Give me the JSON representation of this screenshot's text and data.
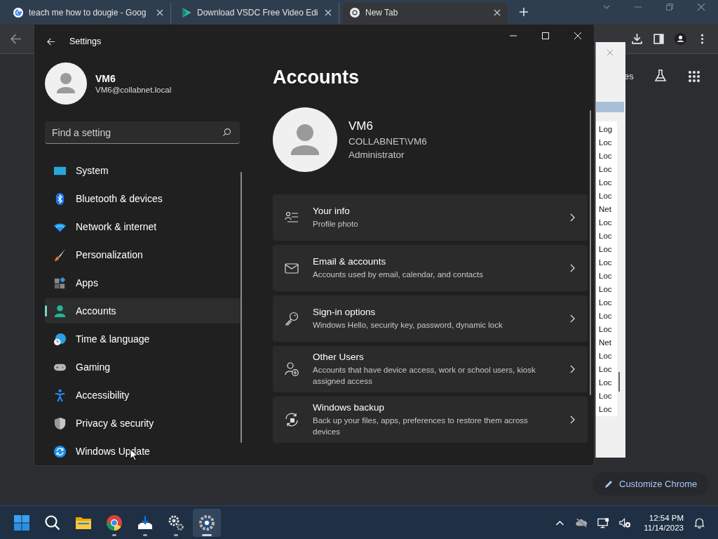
{
  "browser": {
    "tabs": [
      {
        "title": "teach me how to dougie - Goog",
        "kind": "google",
        "selected": false
      },
      {
        "title": "Download VSDC Free Video Edi",
        "kind": "vsdc",
        "selected": false
      },
      {
        "title": "New Tab",
        "kind": "chrome",
        "selected": true
      }
    ]
  },
  "new_tab": {
    "partial_link": "es",
    "customize_button": "Customize Chrome"
  },
  "background_dialog": {
    "rows": [
      "Log",
      "Loc",
      "Loc",
      "Loc",
      "Loc",
      "Loc",
      "Net",
      "Loc",
      "Loc",
      "Loc",
      "Loc",
      "Loc",
      "Loc",
      "Loc",
      "Loc",
      "Loc",
      "Net",
      "Loc",
      "Loc",
      "Loc",
      "Loc",
      "Loc"
    ]
  },
  "settings": {
    "window_title": "Settings",
    "user": {
      "name": "VM6",
      "email": "VM6@collabnet.local"
    },
    "search": {
      "placeholder": "Find a setting"
    },
    "nav": [
      {
        "label": "System",
        "kind": "system",
        "selected": false
      },
      {
        "label": "Bluetooth & devices",
        "kind": "bluetooth",
        "selected": false
      },
      {
        "label": "Network & internet",
        "kind": "network",
        "selected": false
      },
      {
        "label": "Personalization",
        "kind": "brush",
        "selected": false
      },
      {
        "label": "Apps",
        "kind": "apps",
        "selected": false
      },
      {
        "label": "Accounts",
        "kind": "accounts",
        "selected": true
      },
      {
        "label": "Time & language",
        "kind": "time",
        "selected": false
      },
      {
        "label": "Gaming",
        "kind": "gaming",
        "selected": false
      },
      {
        "label": "Accessibility",
        "kind": "accessibility",
        "selected": false
      },
      {
        "label": "Privacy & security",
        "kind": "shield",
        "selected": false
      },
      {
        "label": "Windows Update",
        "kind": "update",
        "selected": false
      }
    ],
    "page_title": "Accounts",
    "account": {
      "name": "VM6",
      "domain": "COLLABNET\\VM6",
      "role": "Administrator"
    },
    "cards": [
      {
        "title": "Your info",
        "subtitle": "Profile photo",
        "kind": "info"
      },
      {
        "title": "Email & accounts",
        "subtitle": "Accounts used by email, calendar, and contacts",
        "kind": "mail"
      },
      {
        "title": "Sign-in options",
        "subtitle": "Windows Hello, security key, password, dynamic lock",
        "kind": "key"
      },
      {
        "title": "Other Users",
        "subtitle": "Accounts that have device access, work or school users, kiosk assigned access",
        "kind": "users"
      },
      {
        "title": "Windows backup",
        "subtitle": "Back up your files, apps, preferences to restore them across devices",
        "kind": "backup"
      }
    ]
  },
  "taskbar": {
    "apps": [
      {
        "kind": "start",
        "running": false,
        "selected": false
      },
      {
        "kind": "search",
        "running": false,
        "selected": false
      },
      {
        "kind": "folder",
        "running": false,
        "selected": false
      },
      {
        "kind": "chrome",
        "running": true,
        "selected": false
      },
      {
        "kind": "download",
        "running": true,
        "selected": false
      },
      {
        "kind": "gears",
        "running": true,
        "selected": false
      },
      {
        "kind": "settings",
        "running": true,
        "selected": true
      }
    ],
    "time": "12:54 PM",
    "date": "11/14/2023"
  }
}
